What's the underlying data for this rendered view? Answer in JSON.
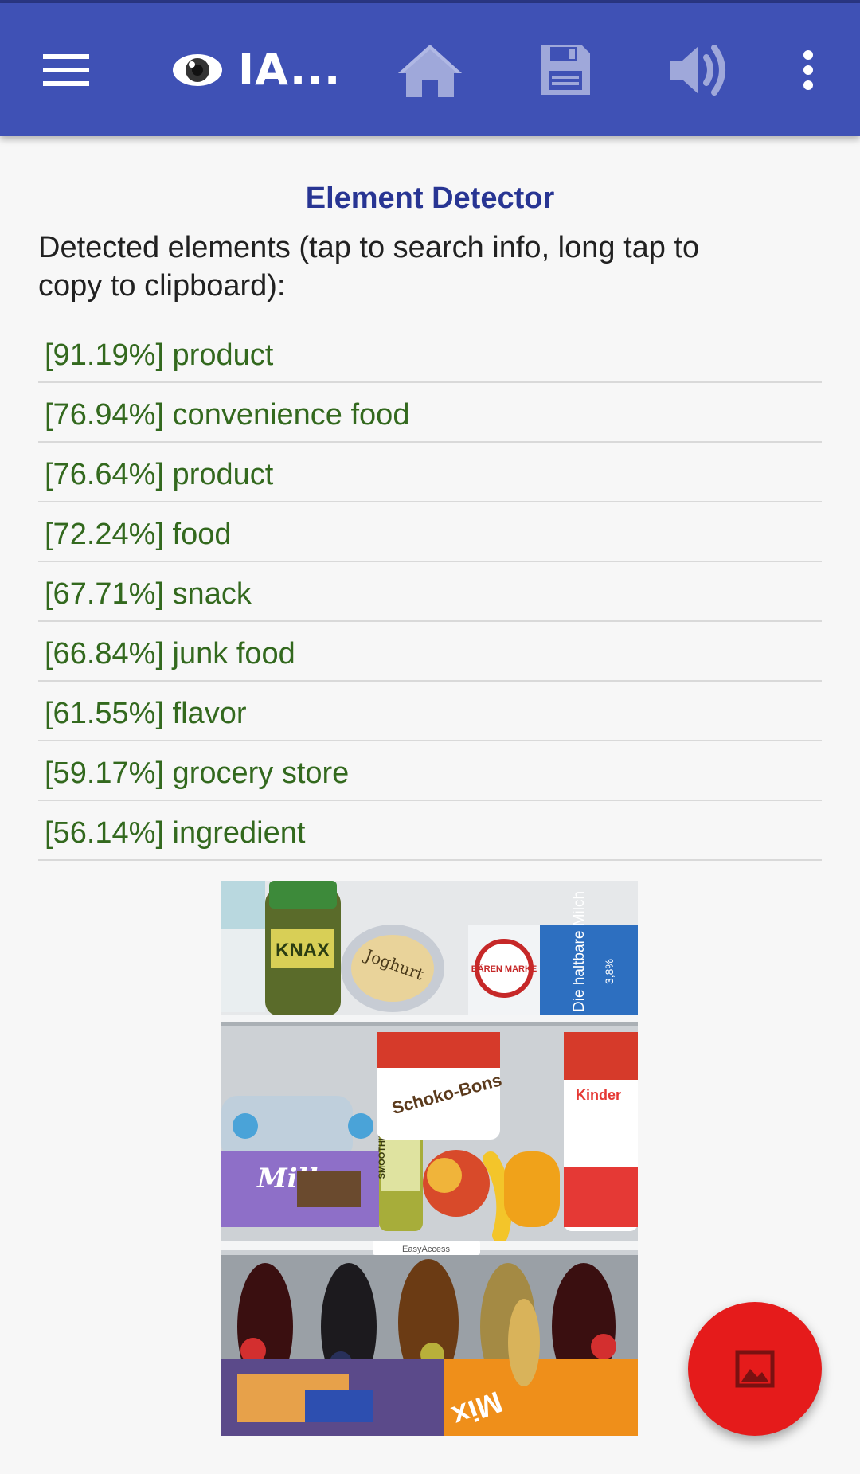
{
  "appbar": {
    "title": "IA...",
    "icons": [
      "menu-icon",
      "eye-icon",
      "home-icon",
      "save-icon",
      "volume-icon",
      "more-vert-icon"
    ],
    "bg_color": "#3f51b5",
    "icon_color": "#9fa8da"
  },
  "main": {
    "heading": "Element Detector",
    "subheading": "Detected elements (tap to search info, long tap to copy to clipboard):",
    "results": [
      "[91.19%] product",
      "[76.94%] convenience food",
      "[76.64%] product",
      "[72.24%] food",
      "[67.71%] snack",
      "[66.84%] junk food",
      "[61.55%] flavor",
      "[59.17%] grocery store",
      "[56.14%] ingredient"
    ],
    "result_color": "#33691e",
    "heading_color": "#283593"
  },
  "photo": {
    "labels": {
      "knax": "KNAX",
      "joghurt": "Joghurt",
      "milch_brand": "BÄREN MARKE",
      "milch": "Die haltbare Milch",
      "milch_fat": "3,8%",
      "schoko_bons": "Schoko-Bons",
      "kinder": "Kinder",
      "milka": "Milka",
      "smoothie": "SMOOTHIE",
      "easyaccess": "EasyAccess",
      "mix": "Mix"
    }
  },
  "fab": {
    "icon": "image-icon",
    "color": "#e51b1b"
  }
}
